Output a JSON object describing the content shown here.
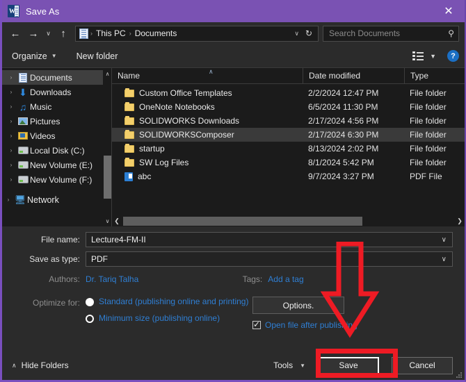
{
  "titlebar": {
    "title": "Save As",
    "app_icon": "word-icon",
    "close_label": "✕"
  },
  "navbar": {
    "back_icon": "←",
    "forward_icon": "→",
    "recent_icon": "∨",
    "up_icon": "↑",
    "address_icon": "documents-folder-icon",
    "breadcrumbs": [
      "This PC",
      "Documents"
    ],
    "separator": "›",
    "dropdown_icon": "∨",
    "refresh_icon": "↻",
    "search_placeholder": "Search Documents",
    "search_value": "",
    "search_icon": "⚲"
  },
  "commandbar": {
    "organize_label": "Organize",
    "organize_caret": "▼",
    "new_folder_label": "New folder",
    "view_caret": "▼",
    "help_label": "?"
  },
  "sidebar": {
    "items": [
      {
        "label": "Documents",
        "icon": "document-icon",
        "expand": "›",
        "selected": true
      },
      {
        "label": "Downloads",
        "icon": "download-icon",
        "expand": "›",
        "selected": false
      },
      {
        "label": "Music",
        "icon": "music-icon",
        "expand": "›",
        "selected": false
      },
      {
        "label": "Pictures",
        "icon": "pictures-icon",
        "expand": "›",
        "selected": false
      },
      {
        "label": "Videos",
        "icon": "videos-icon",
        "expand": "›",
        "selected": false
      },
      {
        "label": "Local Disk (C:)",
        "icon": "disk-icon",
        "expand": "›",
        "selected": false
      },
      {
        "label": "New Volume (E:)",
        "icon": "disk-icon",
        "expand": "›",
        "selected": false
      },
      {
        "label": "New Volume (F:)",
        "icon": "disk-icon",
        "expand": "›",
        "selected": false
      },
      {
        "label": "Network",
        "icon": "network-icon",
        "expand": "›",
        "selected": false
      }
    ],
    "scroll_up_icon": "∧",
    "scroll_down_icon": "∨"
  },
  "filelist": {
    "columns": [
      "Name",
      "Date modified",
      "Type"
    ],
    "sort_indicator": "∧",
    "rows": [
      {
        "name": "Custom Office Templates",
        "date": "2/2/2024 12:47 PM",
        "type": "File folder",
        "icon": "folder-icon",
        "selected": false
      },
      {
        "name": "OneNote Notebooks",
        "date": "6/5/2024 11:30 PM",
        "type": "File folder",
        "icon": "folder-icon",
        "selected": false
      },
      {
        "name": "SOLIDWORKS Downloads",
        "date": "2/17/2024 4:56 PM",
        "type": "File folder",
        "icon": "folder-icon",
        "selected": false
      },
      {
        "name": "SOLIDWORKSComposer",
        "date": "2/17/2024 6:30 PM",
        "type": "File folder",
        "icon": "folder-icon",
        "selected": true
      },
      {
        "name": "startup",
        "date": "8/13/2024 2:02 PM",
        "type": "File folder",
        "icon": "folder-icon",
        "selected": false
      },
      {
        "name": "SW Log Files",
        "date": "8/1/2024 5:42 PM",
        "type": "File folder",
        "icon": "folder-icon",
        "selected": false
      },
      {
        "name": "abc",
        "date": "9/7/2024 3:27 PM",
        "type": "PDF File",
        "icon": "pdf-icon",
        "selected": false
      }
    ],
    "hscroll_left_icon": "❮",
    "hscroll_right_icon": "❯"
  },
  "form": {
    "file_name_label": "File name:",
    "file_name_value": "Lecture4-FM-II",
    "file_name_placeholder": "",
    "save_as_type_label": "Save as type:",
    "save_as_type_value": "PDF",
    "dropdown_icon": "∨",
    "authors_label": "Authors:",
    "authors_value": "Dr. Tariq Talha",
    "tags_label": "Tags:",
    "tags_value": "Add a tag",
    "optimize_label": "Optimize for:",
    "optimize_options": [
      {
        "label": "Standard (publishing online and printing)",
        "selected": false
      },
      {
        "label": "Minimum size (publishing online)",
        "selected": true
      }
    ],
    "options_button": "Options.",
    "open_after_publishing_label": "Open file after publishing",
    "open_after_publishing_checked": true,
    "checkmark": "✓"
  },
  "footer": {
    "hide_folders_label": "Hide Folders",
    "hide_folders_caret": "∧",
    "tools_label": "Tools",
    "tools_caret": "▼",
    "save_label": "Save",
    "cancel_label": "Cancel"
  },
  "annotations": {
    "arrow_color": "#ee1b24",
    "highlight_color": "#ee1b24",
    "arrow_target": "save-button",
    "highlight_target": "save-button"
  },
  "colors": {
    "titlebar": "#7a52b3",
    "dialog_bg": "#2b2b2b",
    "pane_bg": "#1b1b1b",
    "link": "#2f7fd4",
    "accent_red": "#ee1b24"
  }
}
